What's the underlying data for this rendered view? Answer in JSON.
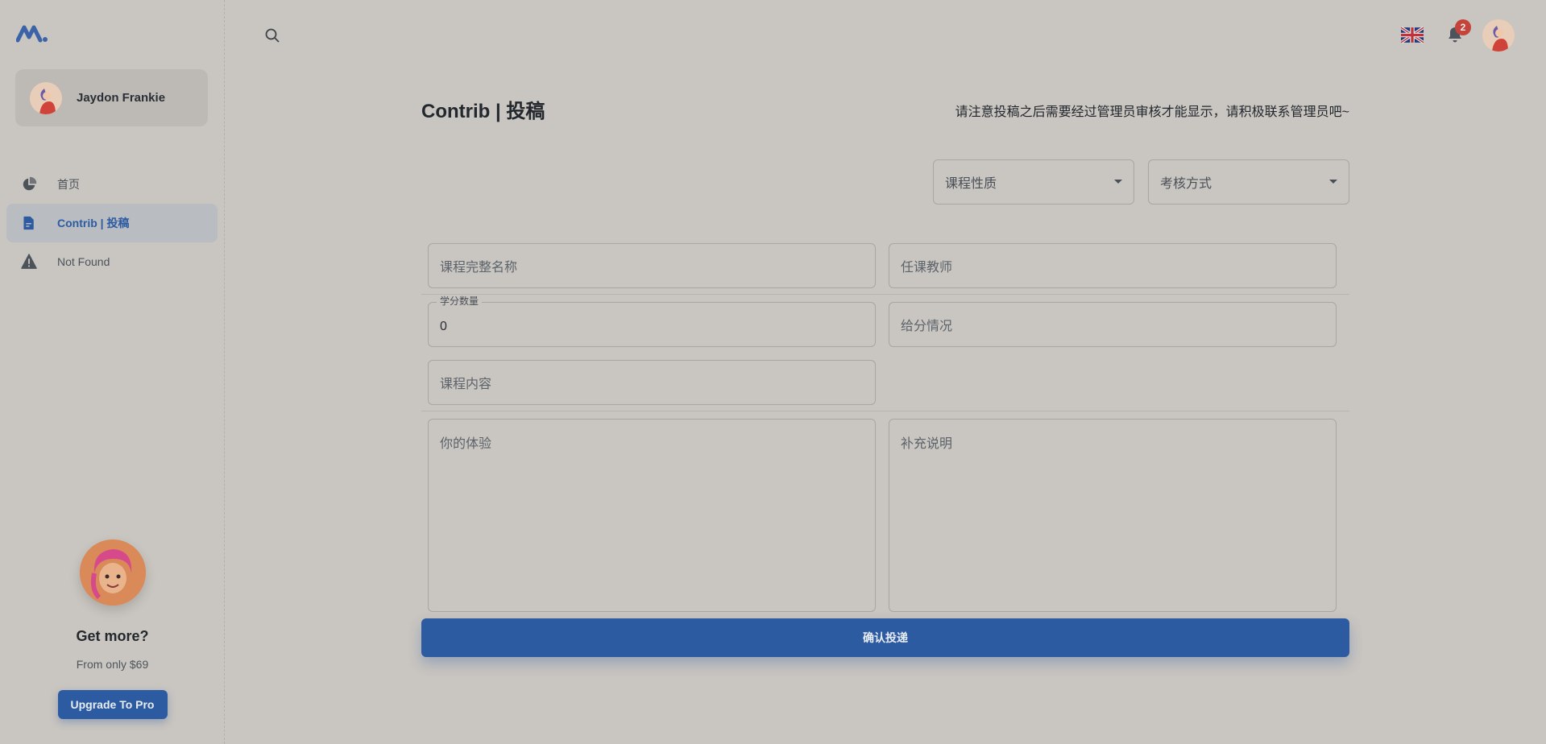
{
  "account": {
    "name": "Jaydon Frankie"
  },
  "nav": {
    "items": [
      {
        "label": "首页",
        "icon": "pie-chart-icon"
      },
      {
        "label": "Contrib | 投稿",
        "icon": "document-icon",
        "active": true
      },
      {
        "label": "Not Found",
        "icon": "warning-icon"
      }
    ]
  },
  "promo": {
    "title": "Get more?",
    "subtitle": "From only $69",
    "button_label": "Upgrade To Pro"
  },
  "topbar": {
    "notification_count": "2",
    "language_icon": "uk-flag-icon"
  },
  "page": {
    "title": "Contrib | 投稿",
    "notice": "请注意投稿之后需要经过管理员审核才能显示，请积极联系管理员吧~"
  },
  "form": {
    "course_type_placeholder": "课程性质",
    "assessment_placeholder": "考核方式",
    "course_name_placeholder": "课程完整名称",
    "teacher_placeholder": "任课教师",
    "credits_label": "学分数量",
    "credits_value": "0",
    "grading_placeholder": "给分情况",
    "content_placeholder": "课程内容",
    "experience_placeholder": "你的体验",
    "notes_placeholder": "补充说明",
    "submit_label": "确认投递"
  },
  "colors": {
    "accent": "#2c5ba1",
    "background": "#c9c5c0",
    "badge": "#c4433b"
  }
}
